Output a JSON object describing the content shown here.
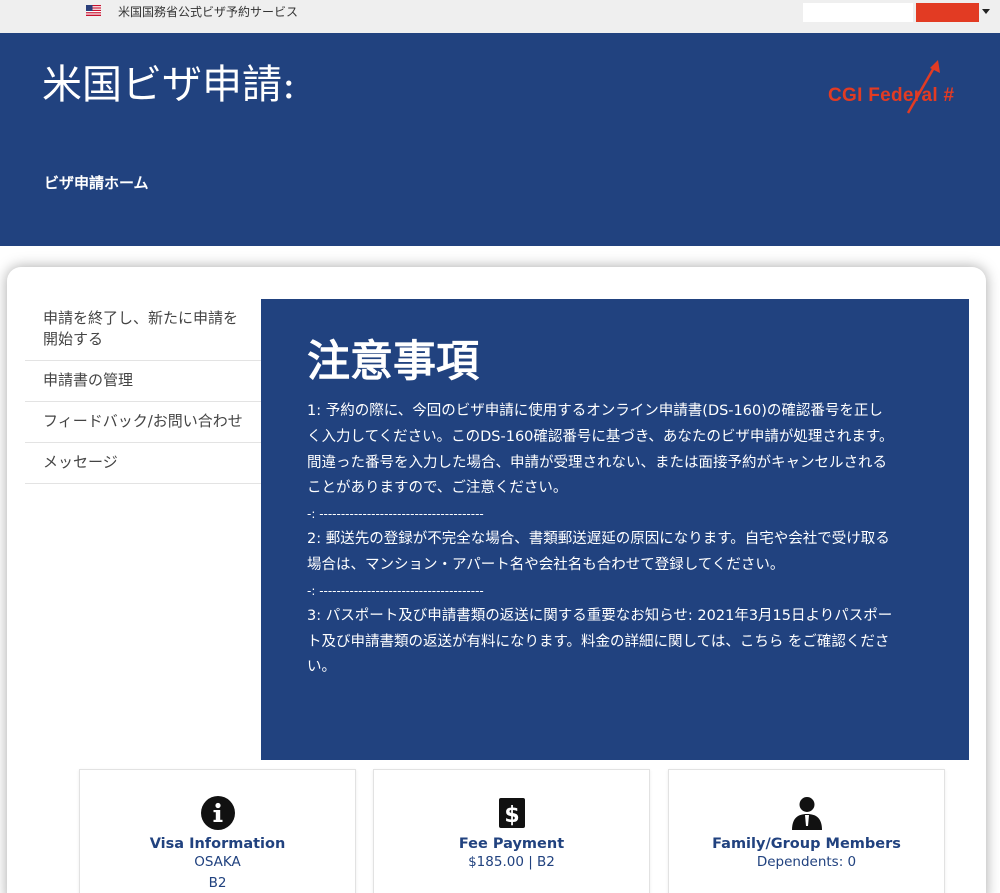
{
  "topbar": {
    "service_name": "米国国務省公式ビザ予約サービス"
  },
  "header": {
    "title": "米国ビザ申請:",
    "breadcrumb": "ビザ申請ホーム"
  },
  "annotation": {
    "label": "CGI  Federal #"
  },
  "sidebar": {
    "items": [
      {
        "label": "申請を終了し、新たに申請を開始する"
      },
      {
        "label": "申請書の管理"
      },
      {
        "label": "フィードバック/お問い合わせ"
      },
      {
        "label": "メッセージ"
      }
    ]
  },
  "notice": {
    "title": "注意事項",
    "item1": "1: 予約の際に、今回のビザ申請に使用するオンライン申請書(DS-160)の確認番号を正しく入力してください。このDS-160確認番号に基づき、あなたのビザ申請が処理されます。間違った番号を入力した場合、申請が受理されない、または面接予約がキャンセルされることがありますので、ご注意ください。",
    "separator": "-: --------------------------------------",
    "item2": "2: 郵送先の登録が不完全な場合、書類郵送遅延の原因になります。自宅や会社で受け取る場合は、マンション・アパート名や会社名も合わせて登録してください。",
    "item3": "3: パスポート及び申請書類の返送に関する重要なお知らせ: 2021年3月15日よりパスポート及び申請書類の返送が有料になります。料金の詳細に関しては、こちら をご確認ください。"
  },
  "tiles": [
    {
      "icon": "info-circle-icon",
      "title": "Visa Information",
      "lines": [
        "OSAKA",
        "B2"
      ]
    },
    {
      "icon": "dollar-icon",
      "title": "Fee Payment",
      "lines": [
        "$185.00 | B2"
      ]
    },
    {
      "icon": "person-icon",
      "title": "Family/Group Members",
      "lines": [
        "Dependents: 0"
      ]
    }
  ],
  "colors": {
    "header_blue": "#21427f",
    "annotation_red": "#e23b23"
  }
}
